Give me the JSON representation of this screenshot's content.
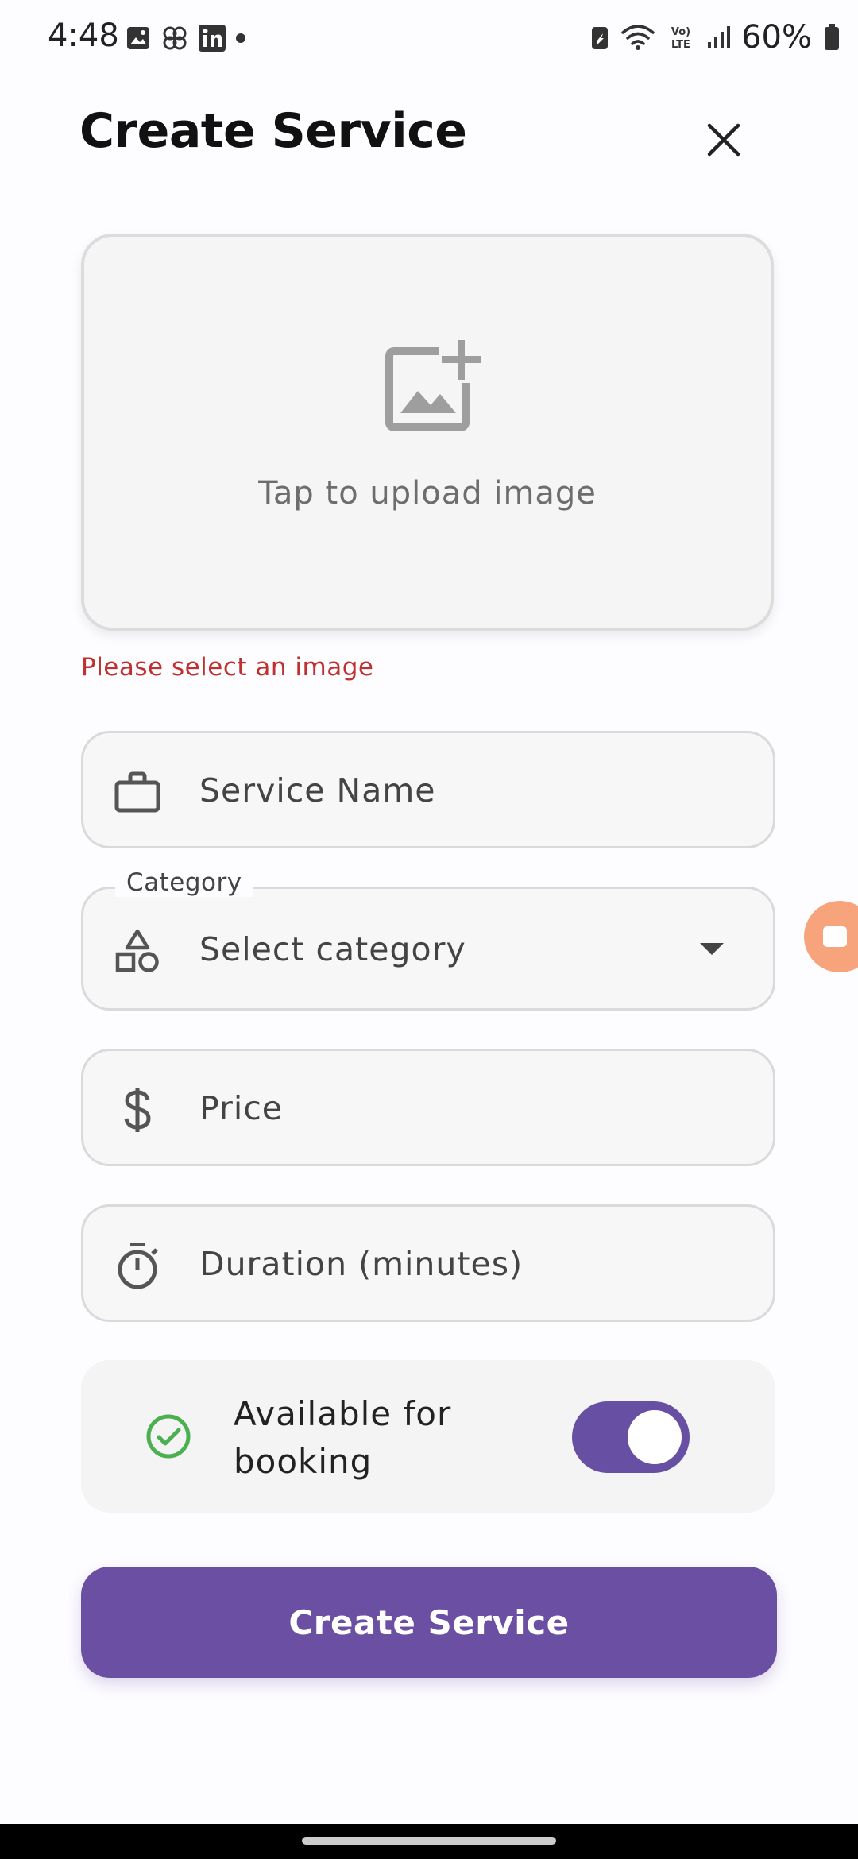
{
  "status_bar": {
    "time": "4:48",
    "battery": "60%",
    "icons": [
      "gallery-icon",
      "pinwheel-icon",
      "linkedin-icon",
      "dot-icon",
      "battery-saver-icon",
      "wifi-icon",
      "volte-icon",
      "signal-icon",
      "battery-icon"
    ]
  },
  "header": {
    "title": "Create Service",
    "close_icon": "close-icon"
  },
  "upload": {
    "icon": "add-image-icon",
    "text": "Tap to upload image",
    "error": "Please select an image"
  },
  "fields": {
    "service_name": {
      "icon": "briefcase-icon",
      "placeholder": "Service Name"
    },
    "category": {
      "icon": "category-shapes-icon",
      "label": "Category",
      "value": "Select category"
    },
    "price": {
      "icon": "dollar-icon",
      "placeholder": "Price"
    },
    "duration": {
      "icon": "timer-icon",
      "placeholder": "Duration (minutes)"
    }
  },
  "availability": {
    "icon": "check-circle-icon",
    "label": "Available for booking",
    "enabled": true
  },
  "submit": {
    "label": "Create Service"
  },
  "colors": {
    "primary": "#6750a4",
    "error": "#c0302f",
    "success": "#4caf50",
    "bubble": "#f7a47d"
  }
}
